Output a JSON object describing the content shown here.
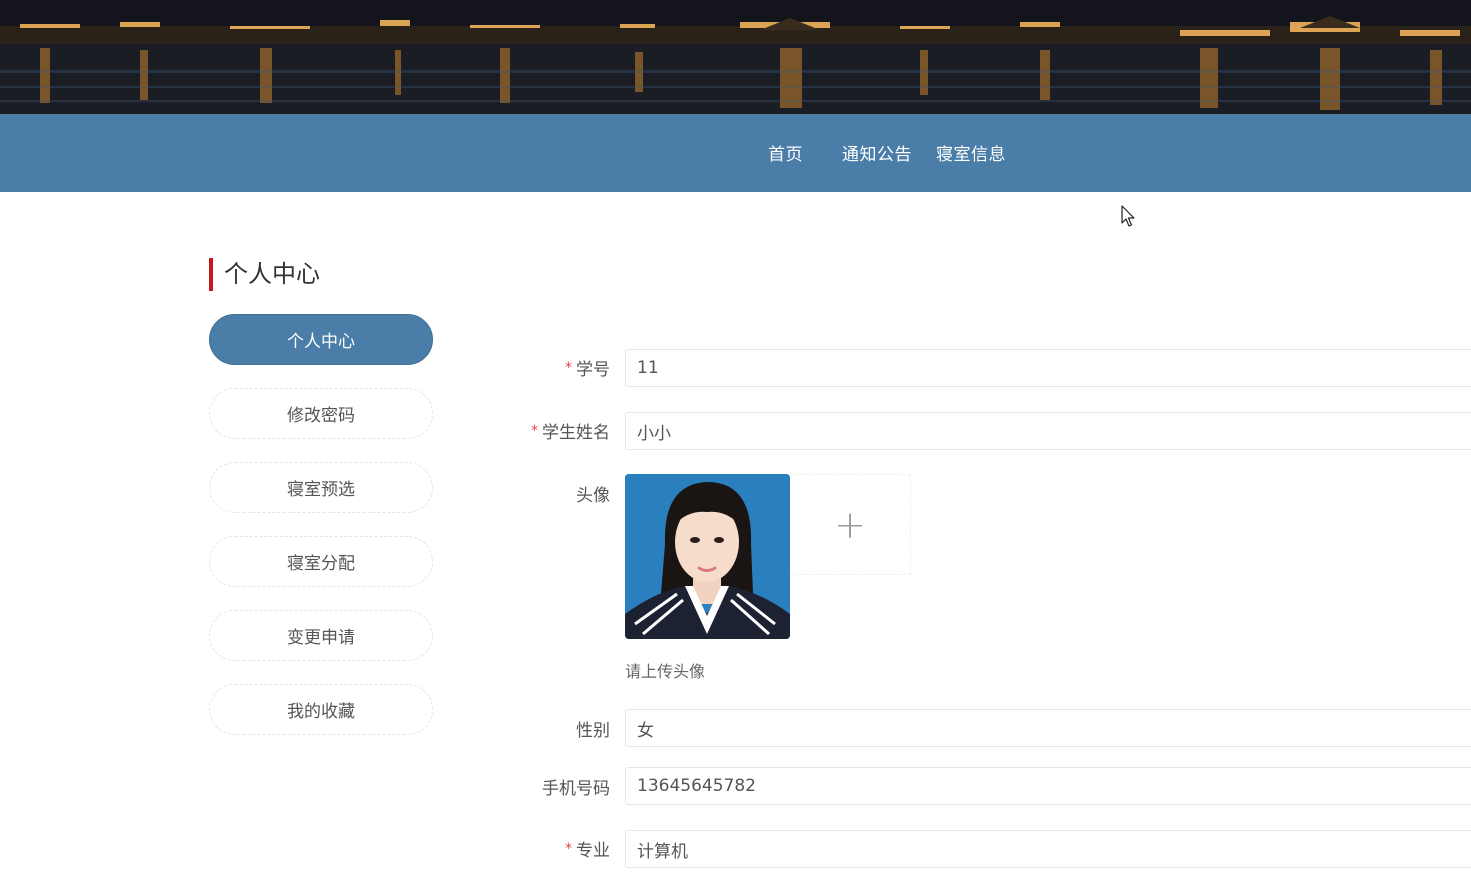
{
  "nav": {
    "items": [
      {
        "label": "首页"
      },
      {
        "label": "通知公告"
      },
      {
        "label": "寝室信息"
      }
    ]
  },
  "sidebar": {
    "title": "个人中心",
    "items": [
      {
        "label": "个人中心",
        "active": true
      },
      {
        "label": "修改密码"
      },
      {
        "label": "寝室预选"
      },
      {
        "label": "寝室分配"
      },
      {
        "label": "变更申请"
      },
      {
        "label": "我的收藏"
      }
    ]
  },
  "form": {
    "student_id": {
      "label": "学号",
      "required_mark": "*",
      "value": "11"
    },
    "student_name": {
      "label": "学生姓名",
      "required_mark": "*",
      "value": "小小"
    },
    "avatar": {
      "label": "头像",
      "upload_tip": "请上传头像",
      "add_glyph": "+"
    },
    "gender": {
      "label": "性别",
      "value": "女"
    },
    "phone": {
      "label": "手机号码",
      "value": "13645645782"
    },
    "major": {
      "label": "专业",
      "required_mark": "*",
      "value": "计算机"
    }
  },
  "colors": {
    "nav_bg": "#4a7ea8",
    "active_btn": "#4a7ea8",
    "title_accent": "#c8161d",
    "required": "#e0474b"
  }
}
